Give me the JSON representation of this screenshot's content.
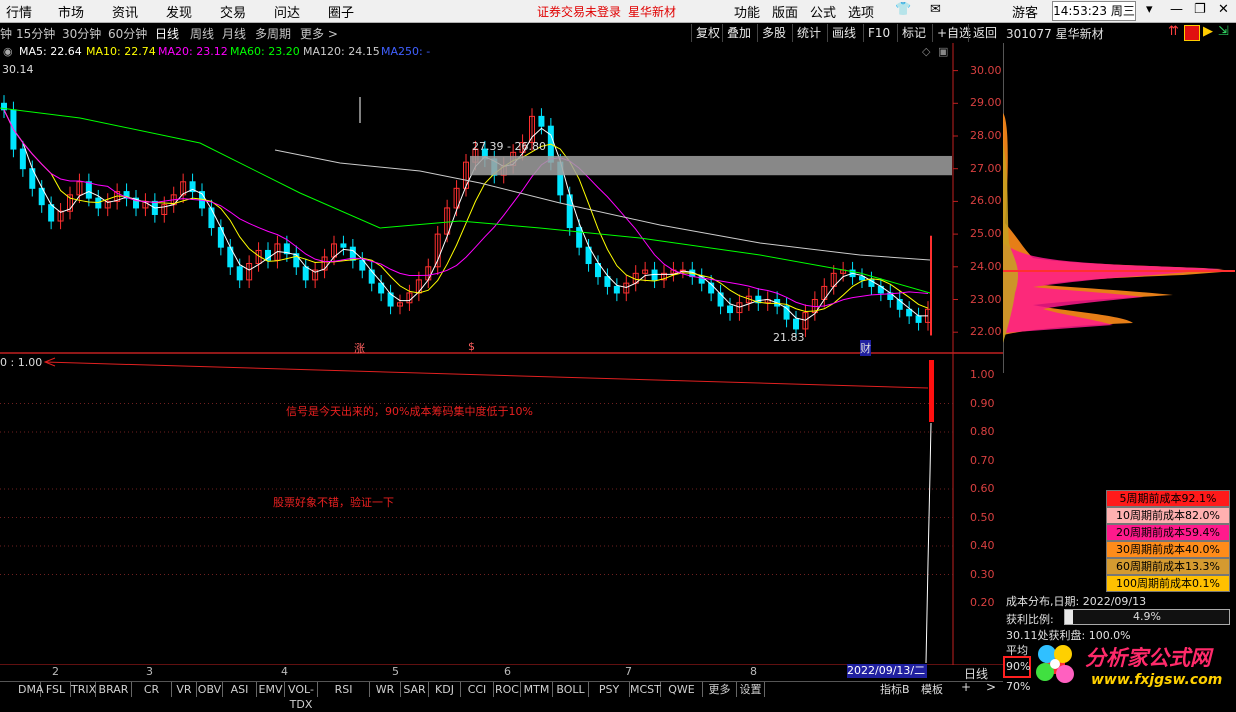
{
  "menu": {
    "items": [
      "行情",
      "市场",
      "资讯",
      "发现",
      "交易",
      "问达",
      "圈子"
    ],
    "notice": "证券交易未登录",
    "stock_title": "星华新材",
    "right_items": [
      "功能",
      "版面",
      "公式",
      "选项"
    ],
    "guest": "游客",
    "clock": "14:53:23 周三"
  },
  "periods": [
    "钟",
    "15分钟",
    "30分钟",
    "60分钟",
    "日线",
    "周线",
    "月线",
    "多周期",
    "更多 >"
  ],
  "active_period": "日线",
  "toolbar": [
    "复权",
    "叠加",
    "多股",
    "统计",
    "画线",
    "F10",
    "标记",
    "+自选",
    "返回"
  ],
  "stock_bar": {
    "code_name": "301077 星华新材"
  },
  "ma_legend": {
    "ma5": "MA5: 22.64",
    "ma10": "MA10: 22.74",
    "ma20": "MA20: 23.12",
    "ma60": "MA60: 23.20",
    "ma120": "MA120: 24.15",
    "ma250": "MA250: -"
  },
  "colors": {
    "up": "#ff3030",
    "down": "#00e5ff",
    "ma5": "#ffffff",
    "ma10": "#ffff00",
    "ma20": "#ff00ff",
    "ma60": "#00ff00",
    "ma120": "#cccccc",
    "ma250": "#4040ff"
  },
  "price_chart": {
    "high_label": "30.14",
    "range_label": "27.39 - 26.80",
    "low_label": "21.83",
    "markers": [
      "涨",
      "$",
      "财"
    ],
    "y_ticks": [
      "30.00",
      "29.00",
      "28.00",
      "27.00",
      "26.00",
      "25.00",
      "24.00",
      "23.00",
      "22.00"
    ]
  },
  "indicator_chart": {
    "left_label": "0 : 1.00",
    "signal_text": "信号是今天出来的，90%成本筹码集中度低于10%",
    "comment_text": "股票好象不错，验证一下",
    "y_ticks": [
      "1.00",
      "0.90",
      "0.80",
      "0.70",
      "0.60",
      "0.50",
      "0.40",
      "0.30",
      "0.20"
    ]
  },
  "x_axis": {
    "month_labels": [
      "2",
      "3",
      "4",
      "5",
      "6",
      "7",
      "8"
    ],
    "date_box": "2022/09/13/二",
    "period_button": "日线"
  },
  "chip_distribution": {
    "rows": [
      {
        "label": "5周期前成本92.1%",
        "color": "#ff1a1a"
      },
      {
        "label": "10周期前成本82.0%",
        "color": "#ffb0b0"
      },
      {
        "label": "20周期前成本59.4%",
        "color": "#ff1a8c"
      },
      {
        "label": "30周期前成本40.0%",
        "color": "#ff8c1a"
      },
      {
        "label": "60周期前成本13.3%",
        "color": "#d49a30"
      },
      {
        "label": "100周期前成本0.1%",
        "color": "#ffc000"
      }
    ],
    "date_line": "成本分布,日期: 2022/09/13",
    "profit_label": "获利比例:",
    "profit_value": "4.9%",
    "profit_line": "30.11处获利盘: 100.0%",
    "avg_label": "平均",
    "pct90": "90%",
    "pct70": "70%"
  },
  "indicator_tabs": [
    "DMA",
    "FSL",
    "TRIX",
    "BRAR",
    "CR",
    "VR",
    "OBV",
    "ASI",
    "EMV",
    "VOL-TDX",
    "RSI",
    "WR",
    "SAR",
    "KDJ",
    "CCI",
    "ROC",
    "MTM",
    "BOLL",
    "PSY",
    "MCST",
    "QWE",
    "更多",
    "设置"
  ],
  "bottom_right": {
    "indicator": "指标B",
    "template": "模板",
    "plus": "+",
    "more": ">"
  },
  "watermark": {
    "text": "分析家公式网",
    "url": "www.fxjgsw.com"
  }
}
